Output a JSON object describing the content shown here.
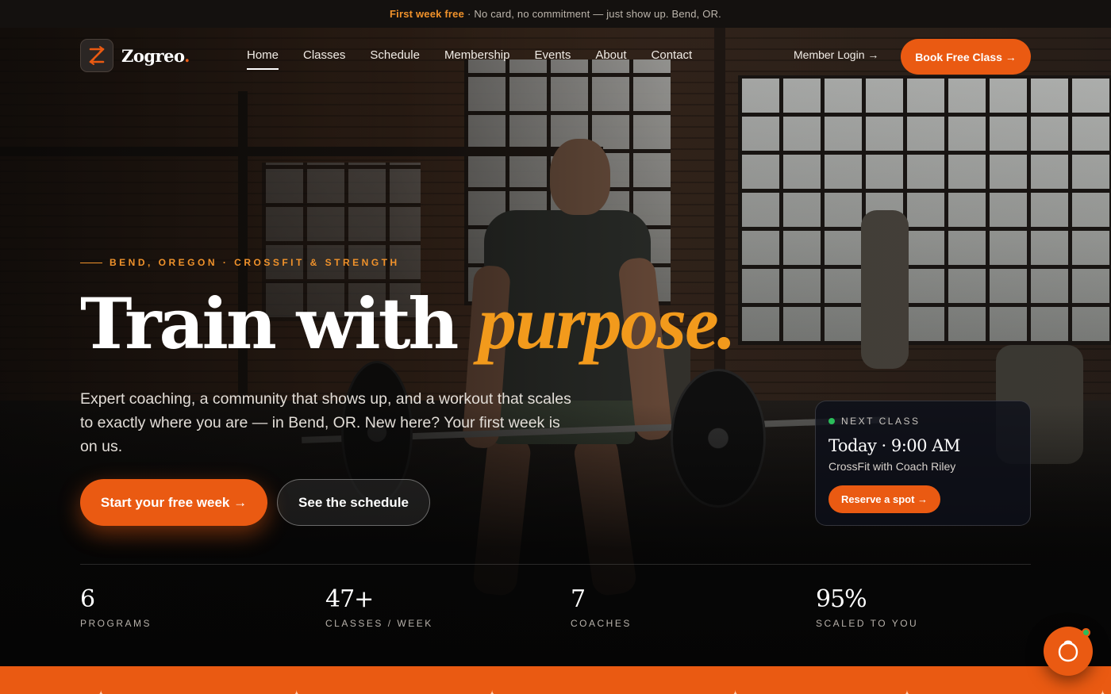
{
  "announcement": {
    "highlight": "First week free",
    "text": "· No card, no commitment — just show up. Bend, OR."
  },
  "brand": {
    "name": "Zogreo",
    "dot": ".",
    "logo_icon": "z-arrows-icon",
    "accent_color": "#ea5a12",
    "highlight_color": "#f29a1c"
  },
  "nav": {
    "links": [
      "Home",
      "Classes",
      "Schedule",
      "Membership",
      "Events",
      "About",
      "Contact"
    ],
    "active": "Home",
    "member_login": "Member Login →",
    "book_cta": "Book Free Class →"
  },
  "hero": {
    "eyebrow": "BEND, OREGON · CROSSFIT & STRENGTH",
    "headline_plain": "Train with ",
    "headline_em": "purpose.",
    "lede": "Expert coaching, a community that shows up, and a workout that scales to exactly where you are — in Bend, OR. New here? Your first week is on us.",
    "primary_cta": "Start your free week →",
    "secondary_cta": "See the schedule"
  },
  "next_class": {
    "label": "NEXT CLASS",
    "time": "Today · 9:00 AM",
    "detail": "CrossFit with Coach Riley",
    "cta": "Reserve a spot →",
    "status_color": "#2bbd5a"
  },
  "stats": [
    {
      "value": "6",
      "label": "PROGRAMS"
    },
    {
      "value": "47+",
      "label": "CLASSES / WEEK"
    },
    {
      "value": "7",
      "label": "COACHES"
    },
    {
      "value": "95%",
      "label": "SCALED TO YOU"
    }
  ],
  "chat": {
    "icon": "chat-bubble-icon",
    "status": "online"
  }
}
